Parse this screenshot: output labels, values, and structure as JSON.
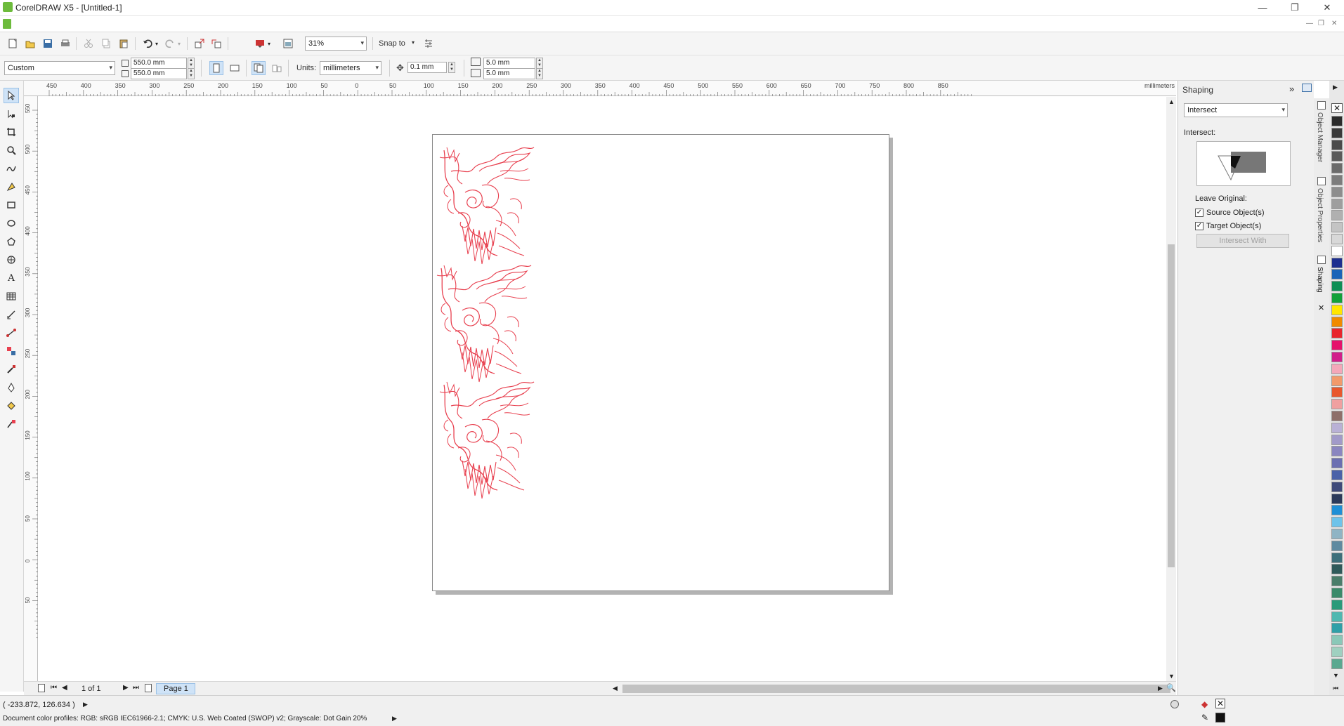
{
  "window": {
    "title": "CorelDRAW X5 - [Untitled-1]"
  },
  "standard_toolbar": {
    "zoom": "31%",
    "snap_to_label": "Snap to"
  },
  "property_bar": {
    "preset": "Custom",
    "page_width": "550.0 mm",
    "page_height": "550.0 mm",
    "units_label": "Units:",
    "units_value": "millimeters",
    "nudge": "0.1 mm",
    "duplicate_x": "5.0 mm",
    "duplicate_y": "5.0 mm"
  },
  "rulers": {
    "unit_label": "millimeters",
    "h_ticks": [
      "450",
      "400",
      "350",
      "300",
      "250",
      "200",
      "150",
      "100",
      "50",
      "0",
      "50",
      "100",
      "150",
      "200",
      "250",
      "300",
      "350",
      "400",
      "450",
      "500",
      "550",
      "600",
      "650",
      "700",
      "750",
      "800",
      "850"
    ],
    "v_ticks": [
      "550",
      "500",
      "450",
      "400",
      "350",
      "300",
      "250",
      "200",
      "150",
      "100",
      "50",
      "0",
      "50"
    ]
  },
  "docker": {
    "title": "Shaping",
    "mode": "Intersect",
    "section_label": "Intersect:",
    "leave_original_label": "Leave Original:",
    "source_objects_label": "Source Object(s)",
    "source_objects_checked": true,
    "target_objects_label": "Target Object(s)",
    "target_objects_checked": true,
    "action_button": "Intersect With",
    "tabs": [
      "Object Manager",
      "Object Properties",
      "Shaping"
    ]
  },
  "page_nav": {
    "counter": "1 of 1",
    "page_tab": "Page 1"
  },
  "status": {
    "coordinates": "( -233.872, 126.634 )",
    "color_profiles": "Document color profiles: RGB: sRGB IEC61966-2.1; CMYK: U.S. Web Coated (SWOP) v2; Grayscale: Dot Gain 20%"
  },
  "palette_colors": [
    "#2b2b2b",
    "#3a3a3a",
    "#4a4a4a",
    "#5a5a5a",
    "#6b6b6b",
    "#7c7c7c",
    "#8d8d8d",
    "#9e9e9e",
    "#b0b0b0",
    "#c4c4c4",
    "#d8d8d8",
    "#ffffff",
    "#1d2f8f",
    "#1a64b8",
    "#0e8f56",
    "#12a13a",
    "#ffe600",
    "#f08a00",
    "#e8262d",
    "#e5136b",
    "#d11f8a",
    "#f4a7b9",
    "#f29a6b",
    "#e8572d",
    "#f0a0a0",
    "#8e6f6a",
    "#b9b1d6",
    "#a19ac9",
    "#8a86c0",
    "#6b6fb1",
    "#4a62a8",
    "#3f4a7a",
    "#2c3a5a",
    "#1f8fd6",
    "#6ec3ea",
    "#8fb4c4",
    "#5f8aa0",
    "#3d6f7a",
    "#2f5a5a",
    "#4a7d6a",
    "#3a8a6a",
    "#2a9a7a",
    "#4fb8b0",
    "#2fa0a8",
    "#8ac8b8",
    "#9fd0c0",
    "#5aa890"
  ],
  "graphic_color": "#e8404f"
}
